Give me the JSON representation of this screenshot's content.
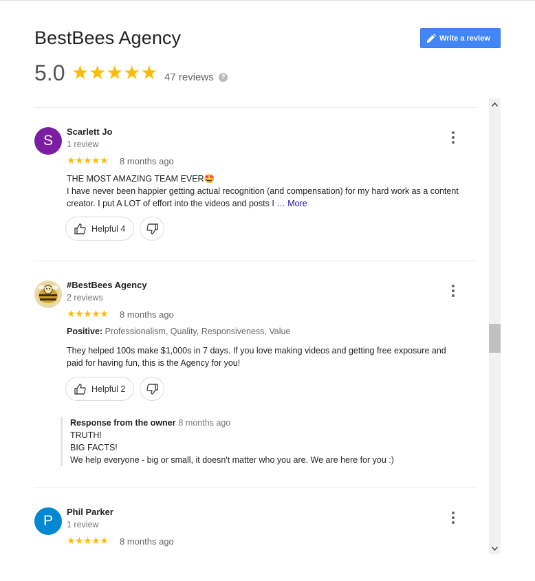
{
  "business": {
    "name": "BestBees Agency",
    "rating": "5.0",
    "stars": "★★★★★",
    "review_count": "47 reviews",
    "help": "?"
  },
  "write_review": {
    "label": "Write a review"
  },
  "reviews": [
    {
      "initial": "S",
      "avatar_color": "#7b1fa2",
      "author": "Scarlett Jo",
      "meta": "1 review",
      "stars": "★★★★★",
      "date": "8 months ago",
      "line1": "THE MOST AMAZING TEAM EVER🤩",
      "line2": "I have never been happier getting actual recognition (and compensation) for my hard work as a content",
      "line3": "creator. I put A LOT of effort into the videos and posts I",
      "ellipsis": " … ",
      "more": "More",
      "helpful": "Helpful 4"
    },
    {
      "author": "#BestBees Agency",
      "meta": "2 reviews",
      "stars": "★★★★★",
      "date": "8 months ago",
      "positive_label": "Positive:",
      "positive_values": "Professionalism, Quality, Responsiveness, Value",
      "line1": "They helped 100s make $1,000s in 7 days. If you love making videos and getting free exposure and",
      "line2": "paid for having fun, this is the Agency for you!",
      "helpful": "Helpful 2",
      "owner_label": "Response from the owner",
      "owner_date": "8 months ago",
      "owner_lines": [
        "TRUTH!",
        "BIG FACTS!",
        "We help everyone - big or small, it doesn't matter who you are. We are here for you :)"
      ]
    },
    {
      "initial": "P",
      "avatar_color": "#0288d1",
      "author": "Phil Parker",
      "meta": "1 review",
      "stars": "★★★★★",
      "date": "8 months ago"
    }
  ],
  "colors": {
    "accent": "#4285f4",
    "star": "#fbbc04",
    "link": "#1a0dab"
  }
}
